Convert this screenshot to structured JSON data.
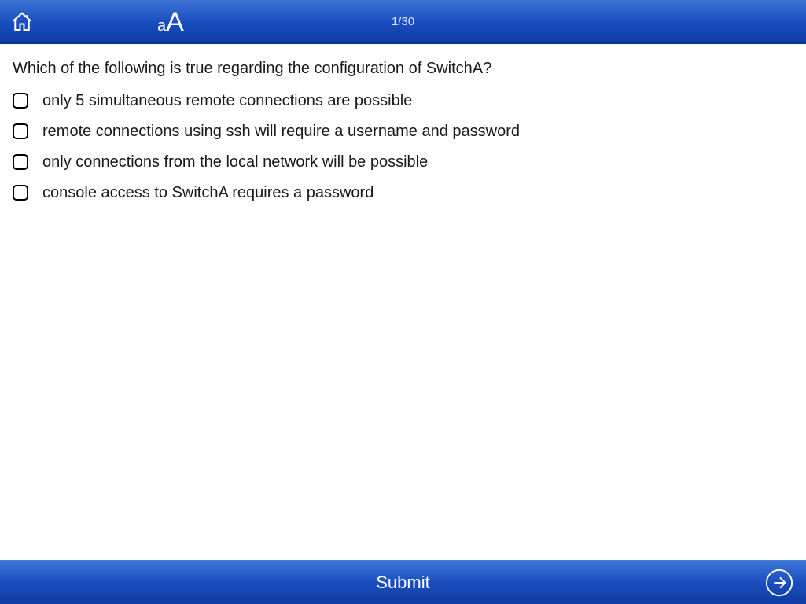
{
  "header": {
    "progress": "1/30",
    "font_small": "a",
    "font_big": "A"
  },
  "quiz": {
    "question": "Which of the following is true regarding the configuration of SwitchA?",
    "options": [
      "only 5 simultaneous remote connections are possible",
      "remote connections using ssh will require a username and password",
      "only connections from the local network will be possible",
      "console access to SwitchA requires a password"
    ]
  },
  "footer": {
    "submit_label": "Submit"
  }
}
